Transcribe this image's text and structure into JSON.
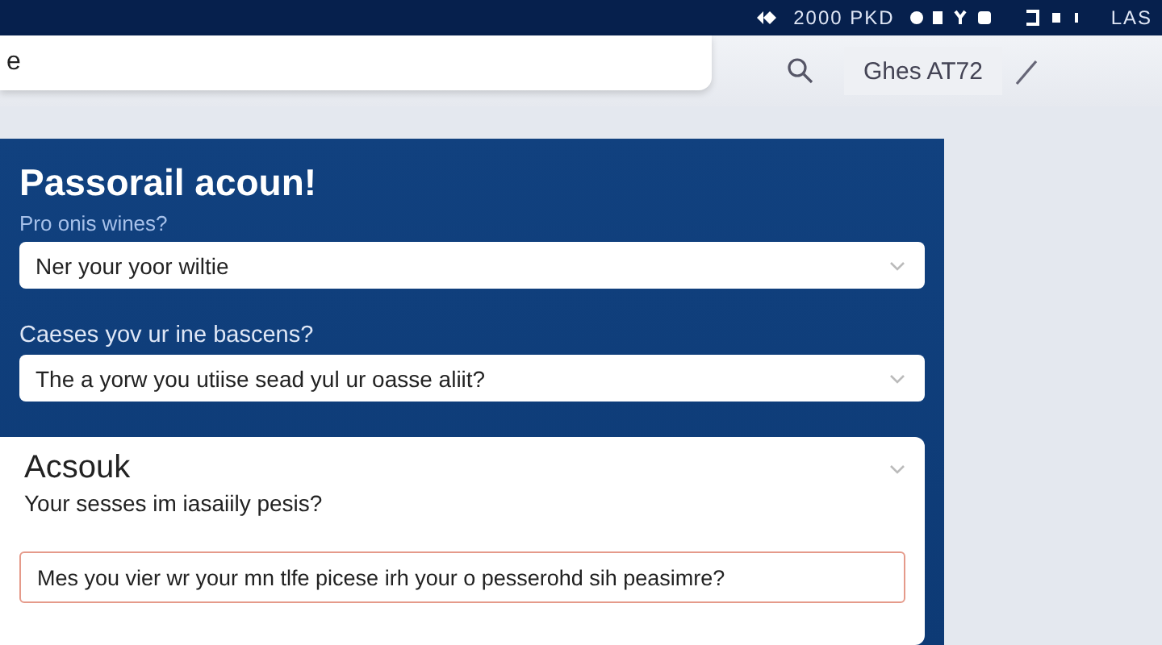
{
  "status_bar": {
    "network": "2000 PKD",
    "label": "LAS"
  },
  "search": {
    "value": "e",
    "button": "Ghes AT72"
  },
  "form": {
    "title": "Passorail acoun!",
    "fields": [
      {
        "label": "Pro onis wines?",
        "value": "Ner your yoor wiltie",
        "kind": "select"
      },
      {
        "label": "Caeses yov ur ine bascens?",
        "value": "The a yorw you utiise sead yul ur oasse aliit?",
        "kind": "select"
      }
    ],
    "card": {
      "title": "Acsouk",
      "subtitle": "Your sesses im iasaiily pesis?",
      "expanded": true,
      "input": {
        "value": "Mes you vier wr your mn tlfe picese irh your o pesserohd sih peasimre?",
        "error": true
      }
    }
  }
}
